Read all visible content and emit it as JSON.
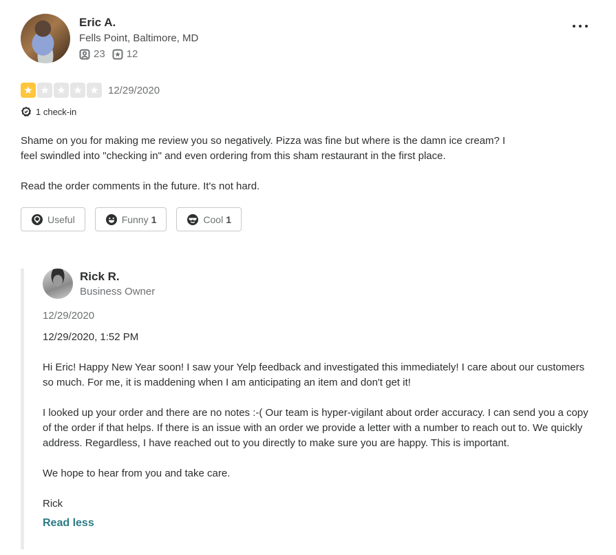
{
  "review": {
    "user": {
      "name": "Eric A.",
      "location": "Fells Point, Baltimore, MD",
      "friends_count": "23",
      "reviews_count": "12"
    },
    "rating": 1,
    "rating_max": 5,
    "date": "12/29/2020",
    "checkin_label": "1 check-in",
    "text": [
      "Shame on you for making me review you so negatively. Pizza was fine but where is the damn ice cream? I feel swindled into \"checking in\" and even ordering from this sham restaurant in the first place.",
      "Read the order comments in the future. It's not hard."
    ],
    "actions": {
      "useful": {
        "label": "Useful",
        "count": ""
      },
      "funny": {
        "label": "Funny",
        "count": "1"
      },
      "cool": {
        "label": "Cool",
        "count": "1"
      }
    },
    "colors": {
      "star_active": "#ffc53d",
      "star_inactive": "#e6e6e6",
      "link": "#2b7b84"
    }
  },
  "owner_reply": {
    "name": "Rick R.",
    "role": "Business Owner",
    "date": "12/29/2020",
    "datetime": "12/29/2020, 1:52 PM",
    "text": [
      "Hi Eric! Happy New Year soon! I saw your Yelp feedback and investigated this immediately! I care about our customers so much. For me, it is maddening when I am anticipating an item and don't get it!",
      "I looked up your order and there are no notes :-(  Our team is hyper-vigilant about order accuracy. I can send you a copy of the order if that helps. If there is an issue with an order we provide a letter with a number to reach out to. We quickly address. Regardless, I have reached out to you directly to make sure you are happy. This is important.",
      "We hope to hear from you and take care.",
      "Rick"
    ],
    "read_less_label": "Read less"
  }
}
